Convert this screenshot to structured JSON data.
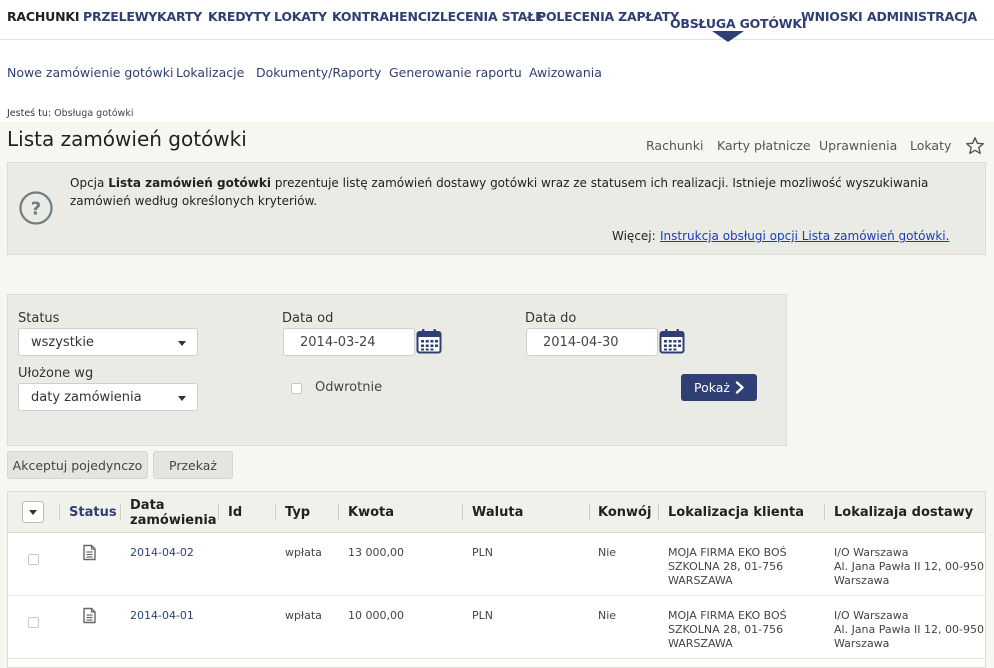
{
  "top_nav": {
    "items": [
      {
        "label": "RACHUNKI"
      },
      {
        "label": "PRZELEWY"
      },
      {
        "label": "KARTY"
      },
      {
        "label": "KREDYTY"
      },
      {
        "label": "LOKATY"
      },
      {
        "label": "KONTRAHENCI"
      },
      {
        "label": "ZLECENIA STAŁE"
      },
      {
        "label": "POLECENIA ZAPŁATY"
      },
      {
        "label": "OBSŁUGA GOTÓWKI"
      },
      {
        "label": "WNIOSKI"
      },
      {
        "label": "ADMINISTRACJA"
      }
    ],
    "active": "OBSŁUGA GOTÓWKI"
  },
  "sub_nav": {
    "items": [
      {
        "label": "Nowe zamówienie gotówki"
      },
      {
        "label": "Lokalizacje"
      },
      {
        "label": "Dokumenty/Raporty"
      },
      {
        "label": "Generowanie raportu"
      },
      {
        "label": "Awizowania"
      }
    ]
  },
  "breadcrumb": {
    "prefix": "Jesteś tu:",
    "current": "Obsługa gotówki"
  },
  "page": {
    "title": "Lista zamówień gotówki",
    "quick_links": [
      "Rachunki",
      "Karty płatnicze",
      "Uprawnienia",
      "Lokaty"
    ]
  },
  "info": {
    "text_prefix": "Opcja",
    "text_bold": "Lista zamówień gotówki",
    "text_rest": "prezentuje listę zamówień dostawy gotówki wraz ze statusem ich realizacji. Istnieje mozliwość wyszukiwania zamówień według określonych kryteriów.",
    "more_label": "Więcej:",
    "more_link": "Instrukcja obsługi opcji Lista zamówień gotówki."
  },
  "filters": {
    "status_label": "Status",
    "status_value": "wszystkie",
    "sort_label": "Ułożone wg",
    "sort_value": "daty zamówienia",
    "date_from_label": "Data od",
    "date_from_value": "2014-03-24",
    "date_to_label": "Data do",
    "date_to_value": "2014-04-30",
    "reverse_label": "Odwrotnie",
    "show_button": "Pokaż"
  },
  "actions": {
    "accept_single": "Akceptuj pojedynczo",
    "forward": "Przekaż"
  },
  "table": {
    "headers": {
      "status": "Status",
      "date_line1": "Data",
      "date_line2": "zamówienia",
      "id": "Id",
      "type": "Typ",
      "amount": "Kwota",
      "currency": "Waluta",
      "conversion": "Konwój",
      "client_location": "Lokalizacja klienta",
      "delivery_location": "Lokalizaja dostawy"
    },
    "rows": [
      {
        "date": "2014-04-02",
        "id": "",
        "type": "wpłata",
        "amount": "13 000,00",
        "currency": "PLN",
        "convoy": "Nie",
        "client_l1": "MOJA FIRMA EKO BOŚ",
        "client_l2": "SZKOLNA 28, 01-756",
        "client_l3": "WARSZAWA",
        "delivery_l1": "I/O Warszawa",
        "delivery_l2": "Al. Jana Pawła II 12, 00-950",
        "delivery_l3": "Warszawa"
      },
      {
        "date": "2014-04-01",
        "id": "",
        "type": "wpłata",
        "amount": "10 000,00",
        "currency": "PLN",
        "convoy": "Nie",
        "client_l1": "MOJA FIRMA EKO BOŚ",
        "client_l2": "SZKOLNA 28, 01-756",
        "client_l3": "WARSZAWA",
        "delivery_l1": "I/O Warszawa",
        "delivery_l2": "Al. Jana Pawła II 12, 00-950",
        "delivery_l3": "Warszawa"
      }
    ]
  },
  "colors": {
    "brand": "#2f3f73",
    "link": "#1a3bbf",
    "panel_bg": "#ebebe5",
    "page_bg": "#f7f7f2"
  },
  "icons": {
    "help": "question-circle-icon",
    "favorite": "star-icon",
    "calendar": "calendar-icon",
    "document": "document-icon",
    "arrow": "chevron-right-icon"
  }
}
